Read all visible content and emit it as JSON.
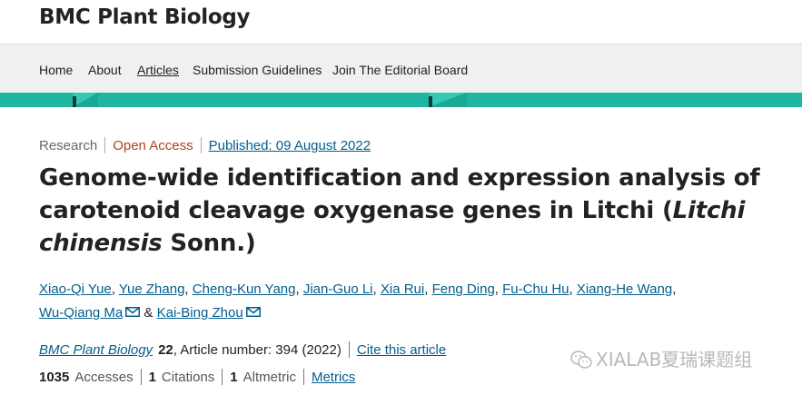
{
  "header": {
    "site_title": "BMC Plant Biology"
  },
  "nav": {
    "items": [
      {
        "label": "Home"
      },
      {
        "label": "About"
      },
      {
        "label": "Articles"
      },
      {
        "label": "Submission Guidelines"
      },
      {
        "label": "Join The Editorial Board"
      }
    ],
    "active": "Articles"
  },
  "article": {
    "type": "Research",
    "access": "Open Access",
    "published": "Published: 09 August 2022",
    "title_part1": "Genome-wide identification and expression analysis of carotenoid cleavage oxygenase genes in Litchi (",
    "title_italic": "Litchi chinensis",
    "title_part2": " Sonn.)",
    "authors": [
      "Xiao-Qi Yue",
      "Yue Zhang",
      "Cheng-Kun Yang",
      "Jian-Guo Li",
      "Xia Rui",
      "Feng Ding",
      "Fu-Chu Hu",
      "Xiang-He Wang",
      "Wu-Qiang Ma",
      "Kai-Bing Zhou"
    ],
    "journal": "BMC Plant Biology",
    "volume": "22",
    "article_number": ", Article number: 394 (2022)",
    "cite_label": "Cite this article",
    "metrics": {
      "accesses_value": "1035",
      "accesses_label": "Accesses",
      "citations_value": "1",
      "citations_label": "Citations",
      "altmetric_value": "1",
      "altmetric_label": "Altmetric",
      "metrics_link": "Metrics"
    }
  },
  "watermark": {
    "text": "XIALAB夏瑞课题组"
  },
  "colors": {
    "accent_stripe": "#1fb6a1",
    "link": "#025e8d",
    "open_access": "#b1431f"
  }
}
